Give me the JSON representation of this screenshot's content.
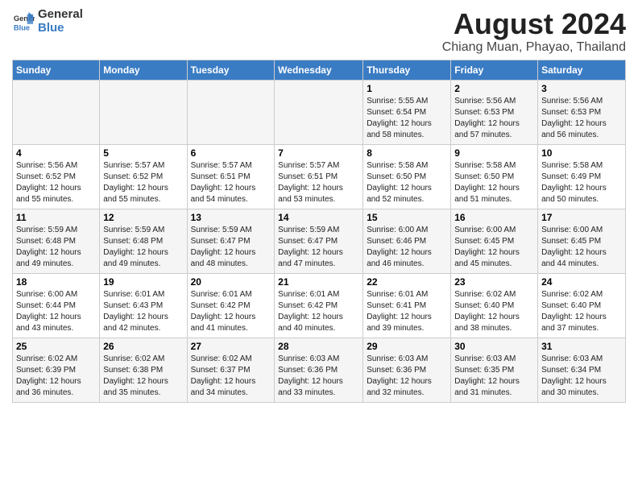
{
  "header": {
    "logo_general": "General",
    "logo_blue": "Blue",
    "title": "August 2024",
    "subtitle": "Chiang Muan, Phayao, Thailand"
  },
  "days_of_week": [
    "Sunday",
    "Monday",
    "Tuesday",
    "Wednesday",
    "Thursday",
    "Friday",
    "Saturday"
  ],
  "weeks": [
    [
      {
        "day": "",
        "info": ""
      },
      {
        "day": "",
        "info": ""
      },
      {
        "day": "",
        "info": ""
      },
      {
        "day": "",
        "info": ""
      },
      {
        "day": "1",
        "info": "Sunrise: 5:55 AM\nSunset: 6:54 PM\nDaylight: 12 hours\nand 58 minutes."
      },
      {
        "day": "2",
        "info": "Sunrise: 5:56 AM\nSunset: 6:53 PM\nDaylight: 12 hours\nand 57 minutes."
      },
      {
        "day": "3",
        "info": "Sunrise: 5:56 AM\nSunset: 6:53 PM\nDaylight: 12 hours\nand 56 minutes."
      }
    ],
    [
      {
        "day": "4",
        "info": "Sunrise: 5:56 AM\nSunset: 6:52 PM\nDaylight: 12 hours\nand 55 minutes."
      },
      {
        "day": "5",
        "info": "Sunrise: 5:57 AM\nSunset: 6:52 PM\nDaylight: 12 hours\nand 55 minutes."
      },
      {
        "day": "6",
        "info": "Sunrise: 5:57 AM\nSunset: 6:51 PM\nDaylight: 12 hours\nand 54 minutes."
      },
      {
        "day": "7",
        "info": "Sunrise: 5:57 AM\nSunset: 6:51 PM\nDaylight: 12 hours\nand 53 minutes."
      },
      {
        "day": "8",
        "info": "Sunrise: 5:58 AM\nSunset: 6:50 PM\nDaylight: 12 hours\nand 52 minutes."
      },
      {
        "day": "9",
        "info": "Sunrise: 5:58 AM\nSunset: 6:50 PM\nDaylight: 12 hours\nand 51 minutes."
      },
      {
        "day": "10",
        "info": "Sunrise: 5:58 AM\nSunset: 6:49 PM\nDaylight: 12 hours\nand 50 minutes."
      }
    ],
    [
      {
        "day": "11",
        "info": "Sunrise: 5:59 AM\nSunset: 6:48 PM\nDaylight: 12 hours\nand 49 minutes."
      },
      {
        "day": "12",
        "info": "Sunrise: 5:59 AM\nSunset: 6:48 PM\nDaylight: 12 hours\nand 49 minutes."
      },
      {
        "day": "13",
        "info": "Sunrise: 5:59 AM\nSunset: 6:47 PM\nDaylight: 12 hours\nand 48 minutes."
      },
      {
        "day": "14",
        "info": "Sunrise: 5:59 AM\nSunset: 6:47 PM\nDaylight: 12 hours\nand 47 minutes."
      },
      {
        "day": "15",
        "info": "Sunrise: 6:00 AM\nSunset: 6:46 PM\nDaylight: 12 hours\nand 46 minutes."
      },
      {
        "day": "16",
        "info": "Sunrise: 6:00 AM\nSunset: 6:45 PM\nDaylight: 12 hours\nand 45 minutes."
      },
      {
        "day": "17",
        "info": "Sunrise: 6:00 AM\nSunset: 6:45 PM\nDaylight: 12 hours\nand 44 minutes."
      }
    ],
    [
      {
        "day": "18",
        "info": "Sunrise: 6:00 AM\nSunset: 6:44 PM\nDaylight: 12 hours\nand 43 minutes."
      },
      {
        "day": "19",
        "info": "Sunrise: 6:01 AM\nSunset: 6:43 PM\nDaylight: 12 hours\nand 42 minutes."
      },
      {
        "day": "20",
        "info": "Sunrise: 6:01 AM\nSunset: 6:42 PM\nDaylight: 12 hours\nand 41 minutes."
      },
      {
        "day": "21",
        "info": "Sunrise: 6:01 AM\nSunset: 6:42 PM\nDaylight: 12 hours\nand 40 minutes."
      },
      {
        "day": "22",
        "info": "Sunrise: 6:01 AM\nSunset: 6:41 PM\nDaylight: 12 hours\nand 39 minutes."
      },
      {
        "day": "23",
        "info": "Sunrise: 6:02 AM\nSunset: 6:40 PM\nDaylight: 12 hours\nand 38 minutes."
      },
      {
        "day": "24",
        "info": "Sunrise: 6:02 AM\nSunset: 6:40 PM\nDaylight: 12 hours\nand 37 minutes."
      }
    ],
    [
      {
        "day": "25",
        "info": "Sunrise: 6:02 AM\nSunset: 6:39 PM\nDaylight: 12 hours\nand 36 minutes."
      },
      {
        "day": "26",
        "info": "Sunrise: 6:02 AM\nSunset: 6:38 PM\nDaylight: 12 hours\nand 35 minutes."
      },
      {
        "day": "27",
        "info": "Sunrise: 6:02 AM\nSunset: 6:37 PM\nDaylight: 12 hours\nand 34 minutes."
      },
      {
        "day": "28",
        "info": "Sunrise: 6:03 AM\nSunset: 6:36 PM\nDaylight: 12 hours\nand 33 minutes."
      },
      {
        "day": "29",
        "info": "Sunrise: 6:03 AM\nSunset: 6:36 PM\nDaylight: 12 hours\nand 32 minutes."
      },
      {
        "day": "30",
        "info": "Sunrise: 6:03 AM\nSunset: 6:35 PM\nDaylight: 12 hours\nand 31 minutes."
      },
      {
        "day": "31",
        "info": "Sunrise: 6:03 AM\nSunset: 6:34 PM\nDaylight: 12 hours\nand 30 minutes."
      }
    ]
  ]
}
